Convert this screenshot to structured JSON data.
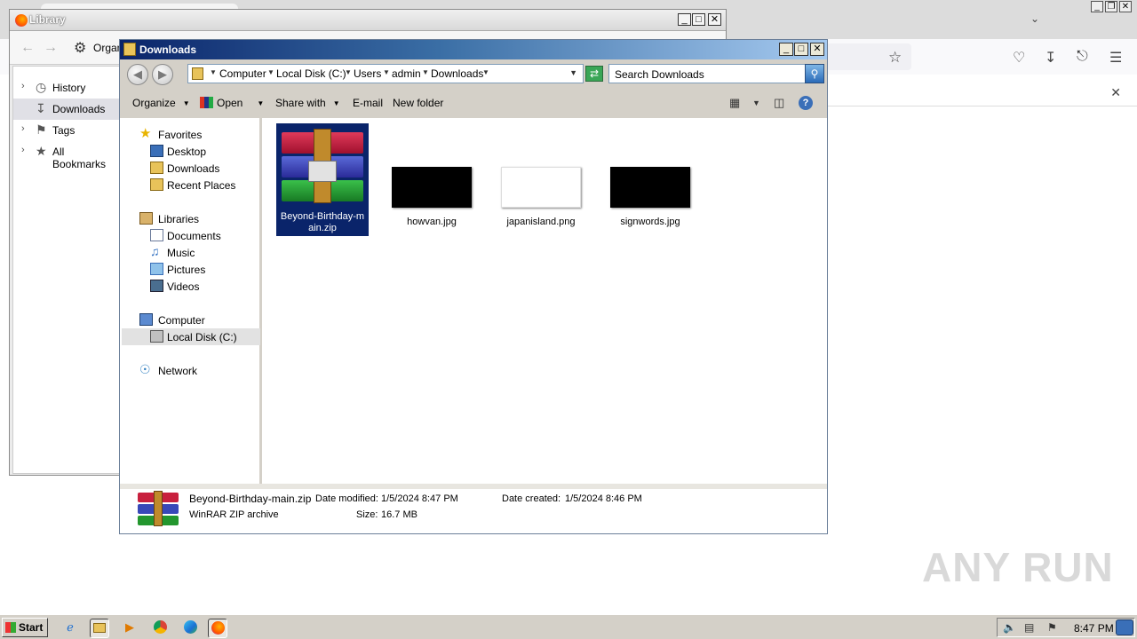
{
  "library": {
    "title": "Library",
    "organize_label": "Organize",
    "sidebar": [
      {
        "label": "History"
      },
      {
        "label": "Downloads"
      },
      {
        "label": "Tags"
      },
      {
        "label": "All Bookmarks"
      }
    ]
  },
  "explorer": {
    "title": "Downloads",
    "breadcrumb": [
      "Computer",
      "Local Disk (C:)",
      "Users",
      "admin",
      "Downloads"
    ],
    "search_placeholder": "Search Downloads",
    "commands": {
      "organize": "Organize",
      "open": "Open",
      "share_with": "Share with",
      "email": "E-mail",
      "new_folder": "New folder"
    },
    "nav": {
      "favorites": "Favorites",
      "desktop": "Desktop",
      "downloads": "Downloads",
      "recent_places": "Recent Places",
      "libraries": "Libraries",
      "documents": "Documents",
      "music": "Music",
      "pictures": "Pictures",
      "videos": "Videos",
      "computer": "Computer",
      "local_disk": "Local Disk (C:)",
      "network": "Network"
    },
    "files": [
      {
        "name": "Beyond-Birthday-main.zip",
        "name_line1": "Beyond-Birthday-m",
        "name_line2": "ain.zip"
      },
      {
        "name": "howvan.jpg"
      },
      {
        "name": "japanisland.png"
      },
      {
        "name": "signwords.jpg"
      }
    ],
    "details": {
      "name": "Beyond-Birthday-main.zip",
      "type": "WinRAR ZIP archive",
      "date_modified_label": "Date modified:",
      "date_modified": "1/5/2024 8:47 PM",
      "size_label": "Size:",
      "size": "16.7 MB",
      "date_created_label": "Date created:",
      "date_created": "1/5/2024 8:46 PM"
    }
  },
  "taskbar": {
    "start_label": "Start",
    "clock": "8:47 PM"
  },
  "watermark": "ANY RUN"
}
